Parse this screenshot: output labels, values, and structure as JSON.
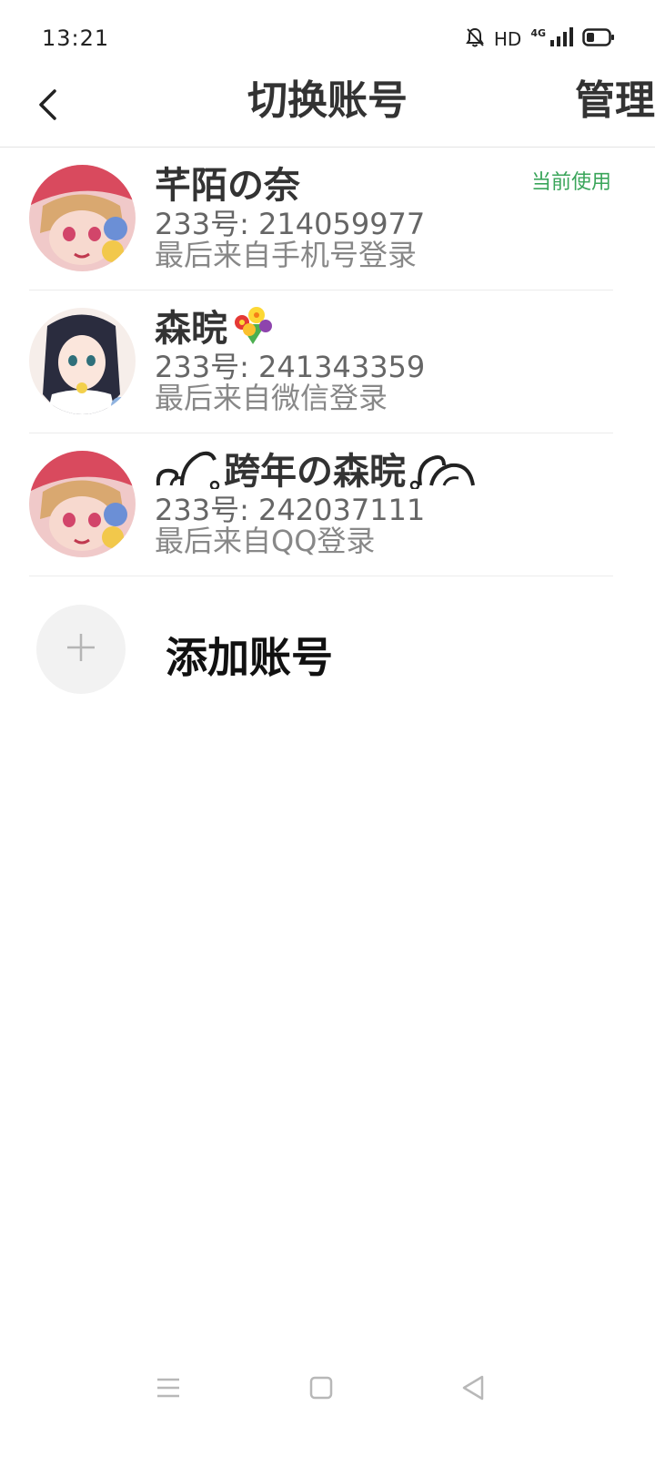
{
  "status_bar": {
    "time": "13:21",
    "hd_label": "HD",
    "network_label": "4G",
    "icons": [
      "bell-muted-icon",
      "signal-icon",
      "battery-icon"
    ]
  },
  "header": {
    "title": "切换账号",
    "manage_label": "管理",
    "back_icon": "chevron-left-icon"
  },
  "accounts": [
    {
      "name": "芊陌の奈",
      "number_text": "233号: 214059977",
      "login_text": "最后来自手机号登录",
      "badge": "当前使用",
      "avatar": "anime-girl-red-cap"
    },
    {
      "name": "森晥",
      "name_suffix_icon": "flower-bouquet-emoji",
      "number_text": "233号: 241343359",
      "login_text": "最后来自微信登录",
      "avatar": "anime-girl-dark-hair"
    },
    {
      "name": "跨年の森晥",
      "name_decoration": "ornament-swirl",
      "number_text": "233号: 242037111",
      "login_text": "最后来自QQ登录",
      "avatar": "anime-girl-red-cap"
    }
  ],
  "add_account": {
    "label": "添加账号",
    "icon": "plus-icon"
  },
  "nav": {
    "icons": [
      "menu-icon",
      "home-square-icon",
      "back-triangle-icon"
    ]
  },
  "colors": {
    "accent_green": "#3aa55a",
    "divider": "#ececec"
  }
}
